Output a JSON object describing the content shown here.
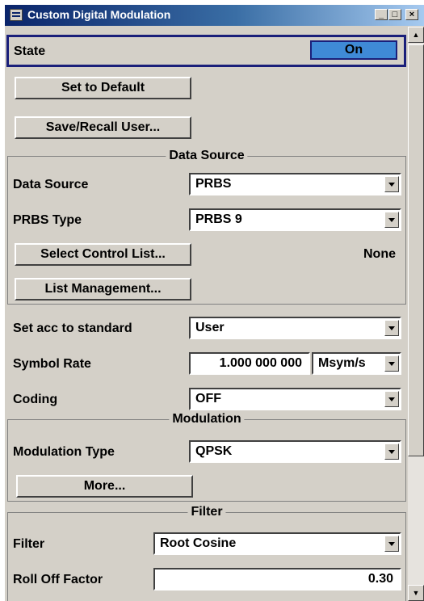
{
  "window": {
    "title": "Custom Digital Modulation",
    "minimize": "_",
    "maximize": "□",
    "close": "×"
  },
  "state": {
    "label": "State",
    "value": "On"
  },
  "buttons": {
    "set_default": "Set to Default",
    "save_recall": "Save/Recall User..."
  },
  "data_source_section": {
    "title": "Data Source",
    "data_source_label": "Data Source",
    "data_source_value": "PRBS",
    "prbs_type_label": "PRBS Type",
    "prbs_type_value": "PRBS 9",
    "select_control_list": "Select Control List...",
    "control_list_value": "None",
    "list_management": "List Management..."
  },
  "general": {
    "standard_label": "Set acc to standard",
    "standard_value": "User",
    "symbol_rate_label": "Symbol Rate",
    "symbol_rate_value": "1.000 000 000",
    "symbol_rate_unit": "Msym/s",
    "coding_label": "Coding",
    "coding_value": "OFF"
  },
  "modulation_section": {
    "title": "Modulation",
    "type_label": "Modulation Type",
    "type_value": "QPSK",
    "more": "More..."
  },
  "filter_section": {
    "title": "Filter",
    "filter_label": "Filter",
    "filter_value": "Root Cosine",
    "rolloff_label": "Roll Off Factor",
    "rolloff_value": "0.30"
  },
  "colors": {
    "title_bar": "#0a246a",
    "state_on": "#3f8ad6",
    "panel": "#d4d0c8"
  }
}
